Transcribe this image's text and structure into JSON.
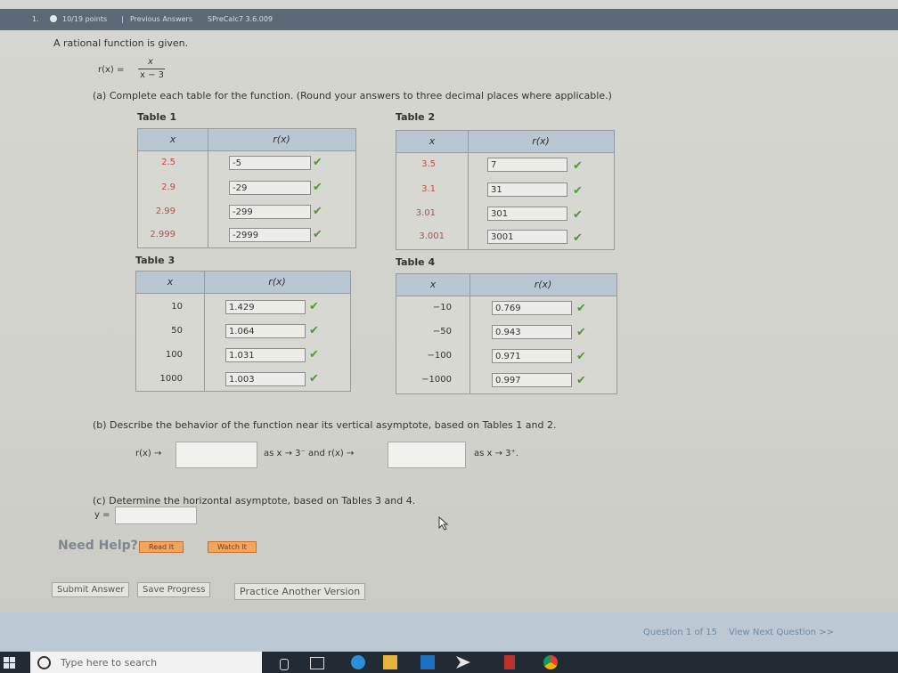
{
  "header": {
    "question_num": "1.",
    "points": "10/19 points",
    "separator": "|",
    "prev_answers": "Previous Answers",
    "code": "SPreCalc7 3.6.009"
  },
  "intro": "A rational function is given.",
  "function": {
    "lhs": "r(x) =",
    "numerator": "x",
    "denominator": "x − 3"
  },
  "part_a": "(a) Complete each table for the function. (Round your answers to three decimal places where applicable.)",
  "table1": {
    "title": "Table 1",
    "col_x": "x",
    "col_r": "r(x)",
    "rows": [
      {
        "x": "2.5",
        "r": "-5"
      },
      {
        "x": "2.9",
        "r": "-29"
      },
      {
        "x": "2.99",
        "r": "-299"
      },
      {
        "x": "2.999",
        "r": "-2999"
      }
    ]
  },
  "table2": {
    "title": "Table 2",
    "col_x": "x",
    "col_r": "r(x)",
    "rows": [
      {
        "x": "3.5",
        "r": "7"
      },
      {
        "x": "3.1",
        "r": "31"
      },
      {
        "x": "3.01",
        "r": "301"
      },
      {
        "x": "3.001",
        "r": "3001"
      }
    ]
  },
  "table3": {
    "title": "Table 3",
    "col_x": "x",
    "col_r": "r(x)",
    "rows": [
      {
        "x": "10",
        "r": "1.429"
      },
      {
        "x": "50",
        "r": "1.064"
      },
      {
        "x": "100",
        "r": "1.031"
      },
      {
        "x": "1000",
        "r": "1.003"
      }
    ]
  },
  "table4": {
    "title": "Table 4",
    "col_x": "x",
    "col_r": "r(x)",
    "rows": [
      {
        "x": "−10",
        "r": "0.769"
      },
      {
        "x": "−50",
        "r": "0.943"
      },
      {
        "x": "−100",
        "r": "0.971"
      },
      {
        "x": "−1000",
        "r": "0.997"
      }
    ]
  },
  "check_glyph": "✔",
  "part_b": {
    "text": "(b) Describe the behavior of the function near its vertical asymptote, based on Tables 1 and 2.",
    "lhs1": "r(x) →",
    "mid": "as x → 3⁻  and  r(x) →",
    "rhs": "as x → 3⁺."
  },
  "part_c": {
    "text": "(c) Determine the horizontal asymptote, based on Tables 3 and 4.",
    "lhs": "y ="
  },
  "help": {
    "label": "Need Help?",
    "read": "Read It",
    "watch": "Watch It"
  },
  "buttons": {
    "submit": "Submit Answer",
    "save": "Save Progress",
    "practice": "Practice Another Version"
  },
  "footer": {
    "question_of": "Question 1 of 15",
    "next": "View Next Question >>"
  },
  "taskbar": {
    "search_placeholder": "Type here to search"
  },
  "colors": {
    "check": "#4a9c2e",
    "header_blue": "#b9c7d4",
    "need_help_orange": "#f2a55d"
  }
}
